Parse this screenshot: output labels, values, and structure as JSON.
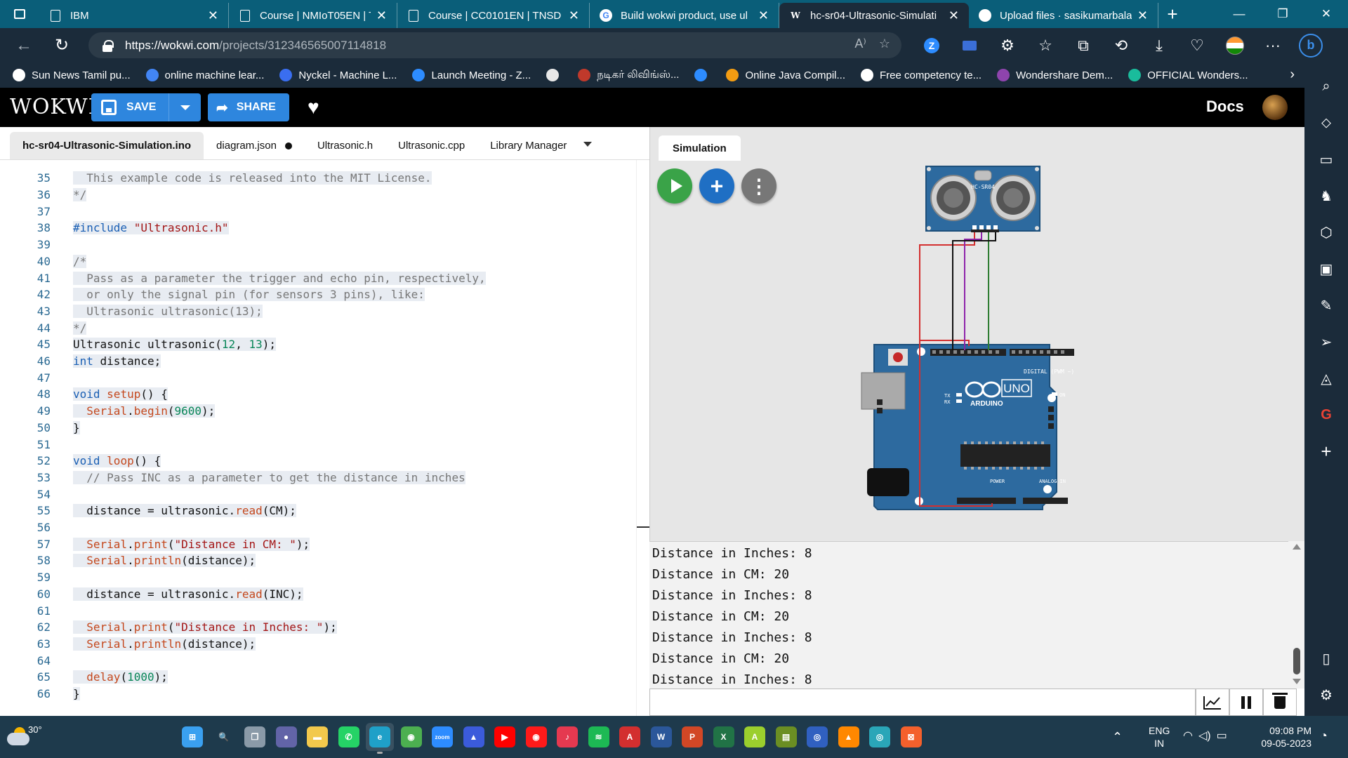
{
  "browser": {
    "tabs": [
      {
        "title": "IBM",
        "icon": "page-icon"
      },
      {
        "title": "Course | NMIoT05EN | TNSD",
        "icon": "page-icon"
      },
      {
        "title": "Course | CC0101EN | TNSD",
        "icon": "page-icon"
      },
      {
        "title": "Build wokwi product, use ul",
        "icon": "google-icon"
      },
      {
        "title": "hc-sr04-Ultrasonic-Simulati",
        "icon": "wokwi-icon",
        "active": true
      },
      {
        "title": "Upload files · sasikumarbala",
        "icon": "github-icon"
      }
    ],
    "url_host": "https://wokwi.com",
    "url_path": "/projects/312346565007114818",
    "bookmarks": [
      {
        "label": "Sun News Tamil pu...",
        "color": "#ffffff"
      },
      {
        "label": "online machine lear...",
        "color": "#4285f4"
      },
      {
        "label": "Nyckel - Machine L...",
        "color": "#3a6ef0"
      },
      {
        "label": "Launch Meeting - Z...",
        "color": "#2d8cff"
      },
      {
        "label": "",
        "color": "#e8e8e8"
      },
      {
        "label": "நடிகர் லிவிங்ஸ்...",
        "color": "#c0392b"
      },
      {
        "label": "",
        "color": "#2d8cff"
      },
      {
        "label": "Online Java Compil...",
        "color": "#f39c12"
      },
      {
        "label": "Free competency te...",
        "color": "#ffffff"
      },
      {
        "label": "Wondershare Dem...",
        "color": "#8e44ad"
      },
      {
        "label": "OFFICIAL Wonders...",
        "color": "#1abc9c"
      }
    ]
  },
  "wokwi": {
    "logo": "WOKWI",
    "save_label": "SAVE",
    "share_label": "SHARE",
    "docs_label": "Docs"
  },
  "editor": {
    "tabs": [
      {
        "label": "hc-sr04-Ultrasonic-Simulation.ino",
        "active": true,
        "modified": false
      },
      {
        "label": "diagram.json",
        "active": false,
        "modified": true
      },
      {
        "label": "Ultrasonic.h",
        "active": false,
        "modified": false
      },
      {
        "label": "Ultrasonic.cpp",
        "active": false,
        "modified": false
      },
      {
        "label": "Library Manager",
        "active": false,
        "modified": false
      }
    ],
    "lines": [
      {
        "n": "35",
        "tokens": [
          [
            "com",
            "  This example code is released into the MIT License."
          ]
        ]
      },
      {
        "n": "36",
        "tokens": [
          [
            "com",
            "*/"
          ]
        ]
      },
      {
        "n": "37",
        "tokens": []
      },
      {
        "n": "38",
        "tokens": [
          [
            "kw",
            "#include "
          ],
          [
            "str",
            "\"Ultrasonic.h\""
          ]
        ]
      },
      {
        "n": "39",
        "tokens": []
      },
      {
        "n": "40",
        "tokens": [
          [
            "com",
            "/*"
          ]
        ]
      },
      {
        "n": "41",
        "tokens": [
          [
            "com",
            "  Pass as a parameter the trigger and echo pin, respectively,"
          ]
        ]
      },
      {
        "n": "42",
        "tokens": [
          [
            "com",
            "  or only the signal pin (for sensors 3 pins), like:"
          ]
        ]
      },
      {
        "n": "43",
        "tokens": [
          [
            "com",
            "  Ultrasonic ultrasonic(13);"
          ]
        ]
      },
      {
        "n": "44",
        "tokens": [
          [
            "com",
            "*/"
          ]
        ]
      },
      {
        "n": "45",
        "tokens": [
          [
            "txt",
            "Ultrasonic ultrasonic("
          ],
          [
            "num",
            "12"
          ],
          [
            "txt",
            ", "
          ],
          [
            "num",
            "13"
          ],
          [
            "txt",
            ");"
          ]
        ]
      },
      {
        "n": "46",
        "tokens": [
          [
            "kw",
            "int"
          ],
          [
            "txt",
            " distance;"
          ]
        ]
      },
      {
        "n": "47",
        "tokens": []
      },
      {
        "n": "48",
        "tokens": [
          [
            "kw",
            "void"
          ],
          [
            "txt",
            " "
          ],
          [
            "fn",
            "setup"
          ],
          [
            "txt",
            "() {"
          ]
        ]
      },
      {
        "n": "49",
        "tokens": [
          [
            "txt",
            "  "
          ],
          [
            "ser",
            "Serial"
          ],
          [
            "txt",
            "."
          ],
          [
            "fn",
            "begin"
          ],
          [
            "txt",
            "("
          ],
          [
            "num",
            "9600"
          ],
          [
            "txt",
            ");"
          ]
        ]
      },
      {
        "n": "50",
        "tokens": [
          [
            "txt",
            "}"
          ]
        ]
      },
      {
        "n": "51",
        "tokens": []
      },
      {
        "n": "52",
        "tokens": [
          [
            "kw",
            "void"
          ],
          [
            "txt",
            " "
          ],
          [
            "fn",
            "loop"
          ],
          [
            "txt",
            "() {"
          ]
        ]
      },
      {
        "n": "53",
        "tokens": [
          [
            "com",
            "  // Pass INC as a parameter to get the distance in inches"
          ]
        ]
      },
      {
        "n": "54",
        "tokens": []
      },
      {
        "n": "55",
        "tokens": [
          [
            "txt",
            "  distance = ultrasonic."
          ],
          [
            "fn",
            "read"
          ],
          [
            "txt",
            "(CM);"
          ]
        ]
      },
      {
        "n": "56",
        "tokens": []
      },
      {
        "n": "57",
        "tokens": [
          [
            "txt",
            "  "
          ],
          [
            "ser",
            "Serial"
          ],
          [
            "txt",
            "."
          ],
          [
            "fn",
            "print"
          ],
          [
            "txt",
            "("
          ],
          [
            "str",
            "\"Distance in CM: \""
          ],
          [
            "txt",
            ");"
          ]
        ]
      },
      {
        "n": "58",
        "tokens": [
          [
            "txt",
            "  "
          ],
          [
            "ser",
            "Serial"
          ],
          [
            "txt",
            "."
          ],
          [
            "fn",
            "println"
          ],
          [
            "txt",
            "(distance);"
          ]
        ]
      },
      {
        "n": "59",
        "tokens": []
      },
      {
        "n": "60",
        "tokens": [
          [
            "txt",
            "  distance = ultrasonic."
          ],
          [
            "fn",
            "read"
          ],
          [
            "txt",
            "(INC);"
          ]
        ]
      },
      {
        "n": "61",
        "tokens": []
      },
      {
        "n": "62",
        "tokens": [
          [
            "txt",
            "  "
          ],
          [
            "ser",
            "Serial"
          ],
          [
            "txt",
            "."
          ],
          [
            "fn",
            "print"
          ],
          [
            "txt",
            "("
          ],
          [
            "str",
            "\"Distance in Inches: \""
          ],
          [
            "txt",
            ");"
          ]
        ]
      },
      {
        "n": "63",
        "tokens": [
          [
            "txt",
            "  "
          ],
          [
            "ser",
            "Serial"
          ],
          [
            "txt",
            "."
          ],
          [
            "fn",
            "println"
          ],
          [
            "txt",
            "(distance);"
          ]
        ]
      },
      {
        "n": "64",
        "tokens": []
      },
      {
        "n": "65",
        "tokens": [
          [
            "txt",
            "  "
          ],
          [
            "fn",
            "delay"
          ],
          [
            "txt",
            "("
          ],
          [
            "num",
            "1000"
          ],
          [
            "txt",
            ");"
          ]
        ]
      },
      {
        "n": "66",
        "tokens": [
          [
            "txt",
            "}"
          ]
        ]
      }
    ]
  },
  "simulation": {
    "tab_label": "Simulation",
    "sensor_label": "HC-SR04",
    "board_labels": {
      "uno": "UNO",
      "arduino": "ARDUINO",
      "digital": "DIGITAL (PWM ~)",
      "power": "POWER",
      "analog": "ANALOG IN",
      "on": "ON",
      "tx": "TX",
      "rx": "RX"
    },
    "serial_lines": [
      "Distance in Inches: 8",
      "Distance in CM: 20",
      "Distance in Inches: 8",
      "Distance in CM: 20",
      "Distance in Inches: 8",
      "Distance in CM: 20",
      "Distance in Inches: 8"
    ]
  },
  "taskbar": {
    "weather_temp": "30°",
    "lang_line1": "ENG",
    "lang_line2": "IN",
    "time": "09:08 PM",
    "date": "09-05-2023",
    "apps": [
      {
        "name": "windows-start",
        "color": "#3aa0f0",
        "glyph": "⊞"
      },
      {
        "name": "search",
        "color": "transparent",
        "glyph": "🔍"
      },
      {
        "name": "task-view",
        "color": "#8a9aa8",
        "glyph": "❐"
      },
      {
        "name": "teams-chat",
        "color": "#6264a7",
        "glyph": "●"
      },
      {
        "name": "file-explorer",
        "color": "#f2c94c",
        "glyph": "▬"
      },
      {
        "name": "whatsapp",
        "color": "#25d366",
        "glyph": "✆"
      },
      {
        "name": "edge",
        "color": "#1fa0c8",
        "glyph": "e",
        "active": true
      },
      {
        "name": "chrome",
        "color": "#4caf50",
        "glyph": "◉"
      },
      {
        "name": "zoom",
        "color": "#2d8cff",
        "glyph": "zoom"
      },
      {
        "name": "app-blue",
        "color": "#3b5bdb",
        "glyph": "▲"
      },
      {
        "name": "youtube",
        "color": "#ff0000",
        "glyph": "▶"
      },
      {
        "name": "youtube-music",
        "color": "#ff1a1a",
        "glyph": "◉"
      },
      {
        "name": "media-player",
        "color": "#e53950",
        "glyph": "♪"
      },
      {
        "name": "spotify",
        "color": "#1db954",
        "glyph": "≋"
      },
      {
        "name": "acrobat",
        "color": "#d32f2f",
        "glyph": "A"
      },
      {
        "name": "word",
        "color": "#2b579a",
        "glyph": "W"
      },
      {
        "name": "powerpoint",
        "color": "#d24726",
        "glyph": "P"
      },
      {
        "name": "excel",
        "color": "#217346",
        "glyph": "X"
      },
      {
        "name": "font-app",
        "color": "#9bcf2d",
        "glyph": "A"
      },
      {
        "name": "image-app",
        "color": "#6b8e23",
        "glyph": "▤"
      },
      {
        "name": "app-circle",
        "color": "#3060c0",
        "glyph": "◎"
      },
      {
        "name": "vlc",
        "color": "#ff8800",
        "glyph": "▲"
      },
      {
        "name": "app-cyan",
        "color": "#2aa6b8",
        "glyph": "◎"
      },
      {
        "name": "app-orange",
        "color": "#f4602c",
        "glyph": "⊠"
      }
    ]
  }
}
